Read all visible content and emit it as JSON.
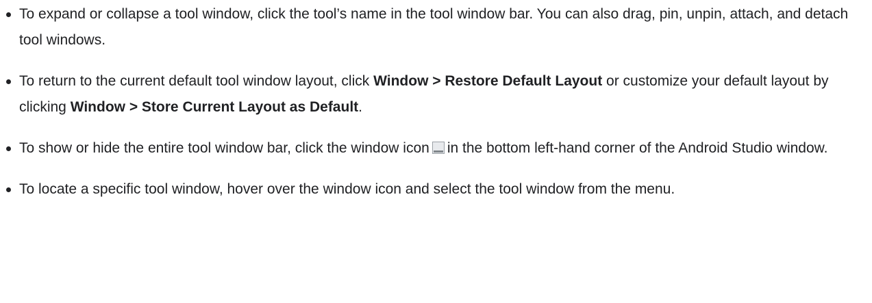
{
  "bullets": [
    {
      "text": "To expand or collapse a tool window, click the tool’s name in the tool window bar. You can also drag, pin, unpin, attach, and detach tool windows."
    },
    {
      "pre": "To return to the current default tool window layout, click ",
      "bold1": "Window > Restore Default Layout",
      "mid": " or customize your default layout by clicking ",
      "bold2": "Window > Store Current Layout as Default",
      "post": "."
    },
    {
      "pre": "To show or hide the entire tool window bar, click the window icon",
      "icon": "window-icon",
      "post": "in the bottom left-hand corner of the Android Studio window."
    },
    {
      "text": "To locate a specific tool window, hover over the window icon and select the tool window from the menu."
    }
  ]
}
